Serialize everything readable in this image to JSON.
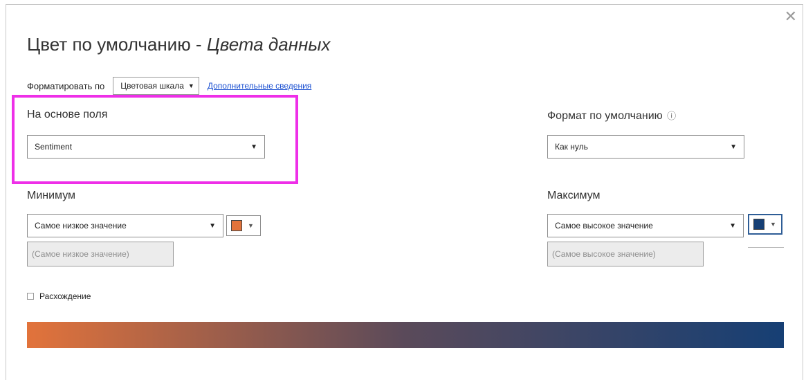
{
  "dialog": {
    "title_main": "Цвет по умолчанию - ",
    "title_italic": "Цвета данных",
    "close_icon": "close-icon"
  },
  "format": {
    "label": "Форматировать по",
    "selected": "Цветовая шкала",
    "link": "Дополнительные сведения"
  },
  "field": {
    "label": "На основе поля",
    "selected": "Sentiment"
  },
  "default_format": {
    "label": "Формат по умолчанию",
    "info_icon": "info-icon",
    "selected": "Как нуль"
  },
  "minimum": {
    "label": "Минимум",
    "selected": "Самое низкое значение",
    "placeholder": "(Самое низкое значение)",
    "color": "#e2733b"
  },
  "maximum": {
    "label": "Максимум",
    "selected": "Самое высокое значение",
    "placeholder": "(Самое высокое значение)",
    "color": "#163f74"
  },
  "divergent": {
    "label": "Расхождение",
    "checked": false
  },
  "colors": {
    "highlight": "#ee2fe8",
    "link": "#1a4fd1",
    "gradient_start": "#e2733b",
    "gradient_end": "#163f74"
  }
}
